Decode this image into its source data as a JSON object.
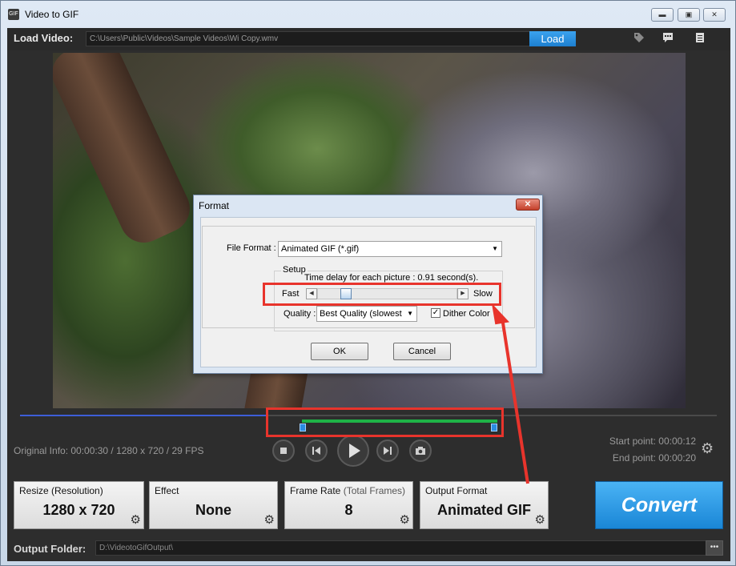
{
  "window": {
    "title": "Video to GIF",
    "minimize": "▬",
    "maximize": "▣",
    "close": "✕",
    "app_icon": "GIF"
  },
  "loadbar": {
    "label": "Load Video:",
    "path": "C:\\Users\\Public\\Videos\\Sample Videos\\Wi Copy.wmv",
    "load_button": "Load",
    "icons": [
      "tag-icon",
      "comment-icon",
      "list-icon"
    ]
  },
  "player": {
    "original_info": "Original Info: 00:00:30 / 1280 x 720 / 29 FPS",
    "start_point": "Start point: 00:00:12",
    "end_point": "End point: 00:00:20",
    "controls": [
      "stop",
      "previous",
      "play",
      "next",
      "snapshot"
    ]
  },
  "panels": {
    "resize": {
      "title": "Resize (Resolution)",
      "value": "1280 x 720"
    },
    "effect": {
      "title": "Effect",
      "value": "None"
    },
    "frame_rate": {
      "title": "Frame Rate",
      "title_sub": "(Total Frames)",
      "value": "8"
    },
    "output_format": {
      "title": "Output Format",
      "value": "Animated GIF"
    }
  },
  "convert_button": "Convert",
  "output": {
    "label": "Output Folder:",
    "path": "D:\\VideotoGifOutput\\",
    "browse": "•••"
  },
  "dialog": {
    "title": "Format",
    "close": "✕",
    "file_format_label": "File Format :",
    "file_format_value": "Animated GIF (*.gif)",
    "setup_title": "Setup",
    "time_delay": "Time delay for each picture : 0.91 second(s).",
    "fast_label": "Fast",
    "slow_label": "Slow",
    "quality_label": "Quality :",
    "quality_value": "Best Quality (slowest",
    "dither_label": "Dither Color",
    "dither_checked": "✓",
    "ok": "OK",
    "cancel": "Cancel",
    "slider_fraction": 0.18
  },
  "colors": {
    "accent": "#1d7fd0",
    "annotation": "#e8342c",
    "range": "#1fb347"
  }
}
